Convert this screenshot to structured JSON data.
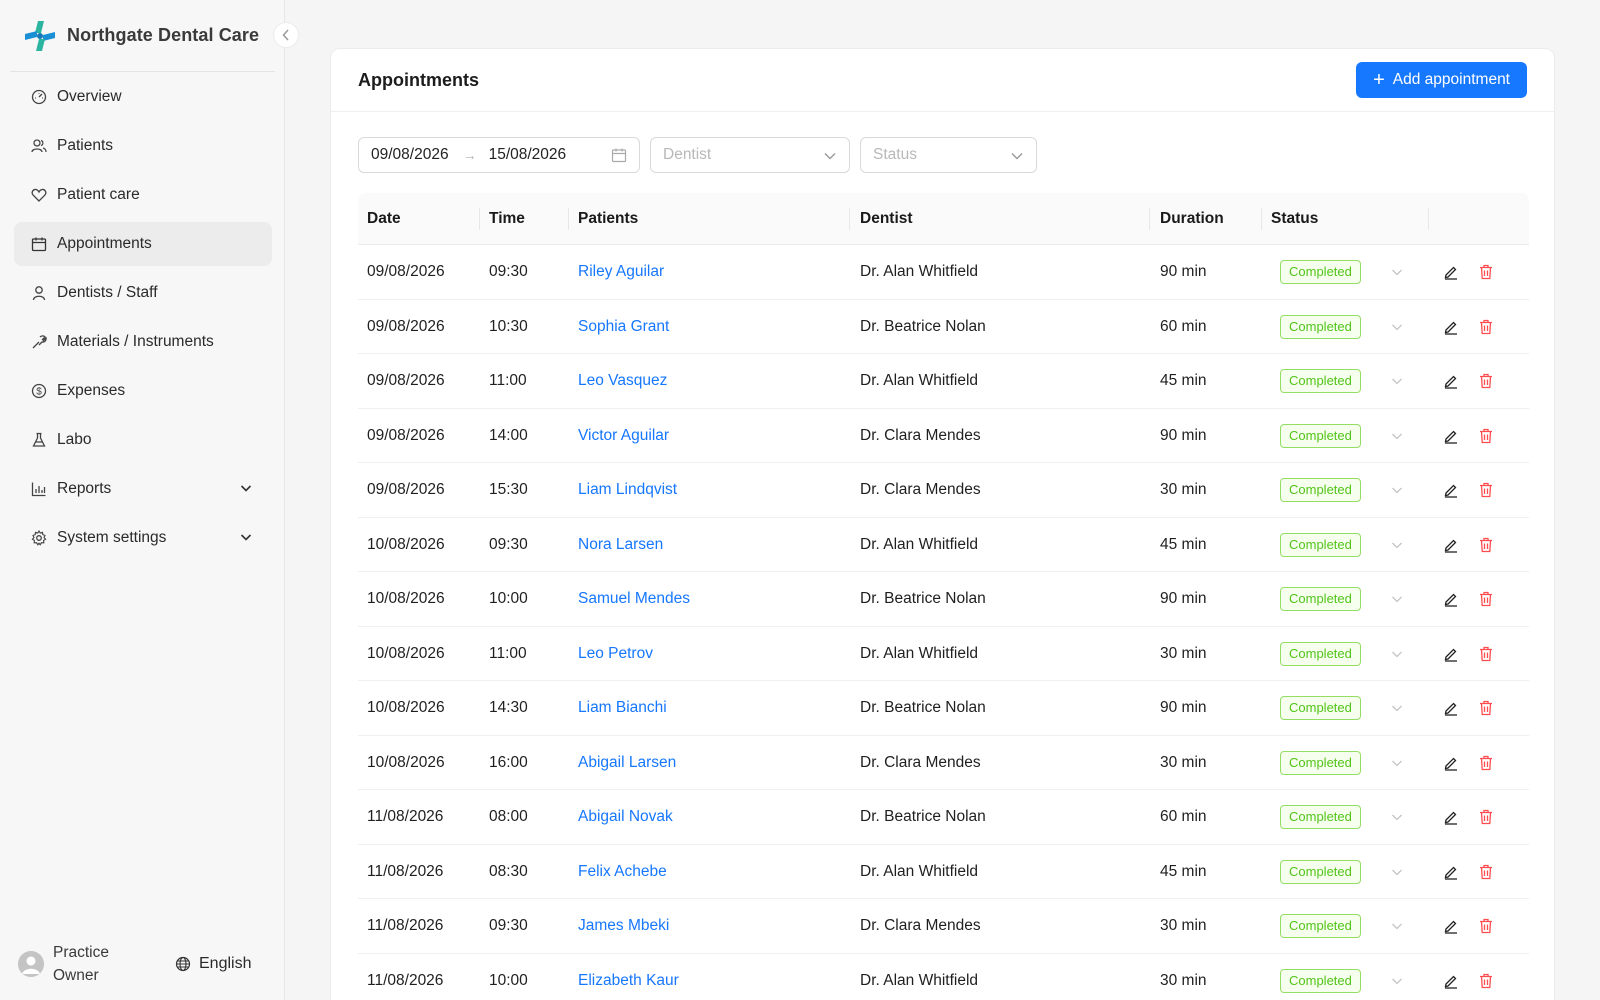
{
  "brand": {
    "name": "Northgate Dental Care"
  },
  "sidebar": {
    "items": [
      {
        "label": "Overview",
        "icon": "dashboard-icon",
        "active": false
      },
      {
        "label": "Patients",
        "icon": "users-icon",
        "active": false
      },
      {
        "label": "Patient care",
        "icon": "heart-icon",
        "active": false
      },
      {
        "label": "Appointments",
        "icon": "calendar-icon",
        "active": true
      },
      {
        "label": "Dentists / Staff",
        "icon": "user-icon",
        "active": false
      },
      {
        "label": "Materials / Instruments",
        "icon": "tool-icon",
        "active": false
      },
      {
        "label": "Expenses",
        "icon": "dollar-icon",
        "active": false
      },
      {
        "label": "Labo",
        "icon": "flask-icon",
        "active": false
      },
      {
        "label": "Reports",
        "icon": "bar-chart-icon",
        "active": false,
        "expandable": true
      },
      {
        "label": "System settings",
        "icon": "gear-icon",
        "active": false,
        "expandable": true
      }
    ]
  },
  "user": {
    "name": "Practice Owner",
    "language": "English"
  },
  "page": {
    "title": "Appointments",
    "add_button": "Add appointment"
  },
  "filters": {
    "date_from": "09/08/2026",
    "date_to": "15/08/2026",
    "dentist_placeholder": "Dentist",
    "status_placeholder": "Status"
  },
  "table": {
    "columns": [
      "Date",
      "Time",
      "Patients",
      "Dentist",
      "Duration",
      "Status"
    ],
    "rows": [
      {
        "date": "09/08/2026",
        "time": "09:30",
        "patient": "Riley Aguilar",
        "dentist": "Dr. Alan Whitfield",
        "duration": "90 min",
        "status": "Completed"
      },
      {
        "date": "09/08/2026",
        "time": "10:30",
        "patient": "Sophia Grant",
        "dentist": "Dr. Beatrice Nolan",
        "duration": "60 min",
        "status": "Completed"
      },
      {
        "date": "09/08/2026",
        "time": "11:00",
        "patient": "Leo Vasquez",
        "dentist": "Dr. Alan Whitfield",
        "duration": "45 min",
        "status": "Completed"
      },
      {
        "date": "09/08/2026",
        "time": "14:00",
        "patient": "Victor Aguilar",
        "dentist": "Dr. Clara Mendes",
        "duration": "90 min",
        "status": "Completed"
      },
      {
        "date": "09/08/2026",
        "time": "15:30",
        "patient": "Liam Lindqvist",
        "dentist": "Dr. Clara Mendes",
        "duration": "30 min",
        "status": "Completed"
      },
      {
        "date": "10/08/2026",
        "time": "09:30",
        "patient": "Nora Larsen",
        "dentist": "Dr. Alan Whitfield",
        "duration": "45 min",
        "status": "Completed"
      },
      {
        "date": "10/08/2026",
        "time": "10:00",
        "patient": "Samuel Mendes",
        "dentist": "Dr. Beatrice Nolan",
        "duration": "90 min",
        "status": "Completed"
      },
      {
        "date": "10/08/2026",
        "time": "11:00",
        "patient": "Leo Petrov",
        "dentist": "Dr. Alan Whitfield",
        "duration": "30 min",
        "status": "Completed"
      },
      {
        "date": "10/08/2026",
        "time": "14:30",
        "patient": "Liam Bianchi",
        "dentist": "Dr. Beatrice Nolan",
        "duration": "90 min",
        "status": "Completed"
      },
      {
        "date": "10/08/2026",
        "time": "16:00",
        "patient": "Abigail Larsen",
        "dentist": "Dr. Clara Mendes",
        "duration": "30 min",
        "status": "Completed"
      },
      {
        "date": "11/08/2026",
        "time": "08:00",
        "patient": "Abigail Novak",
        "dentist": "Dr. Beatrice Nolan",
        "duration": "60 min",
        "status": "Completed"
      },
      {
        "date": "11/08/2026",
        "time": "08:30",
        "patient": "Felix Achebe",
        "dentist": "Dr. Alan Whitfield",
        "duration": "45 min",
        "status": "Completed"
      },
      {
        "date": "11/08/2026",
        "time": "09:30",
        "patient": "James Mbeki",
        "dentist": "Dr. Clara Mendes",
        "duration": "30 min",
        "status": "Completed"
      },
      {
        "date": "11/08/2026",
        "time": "10:00",
        "patient": "Elizabeth Kaur",
        "dentist": "Dr. Alan Whitfield",
        "duration": "30 min",
        "status": "Completed"
      }
    ]
  },
  "colors": {
    "primary": "#1677ff",
    "status_completed": "#52c41a",
    "delete": "#ff4d4f"
  }
}
